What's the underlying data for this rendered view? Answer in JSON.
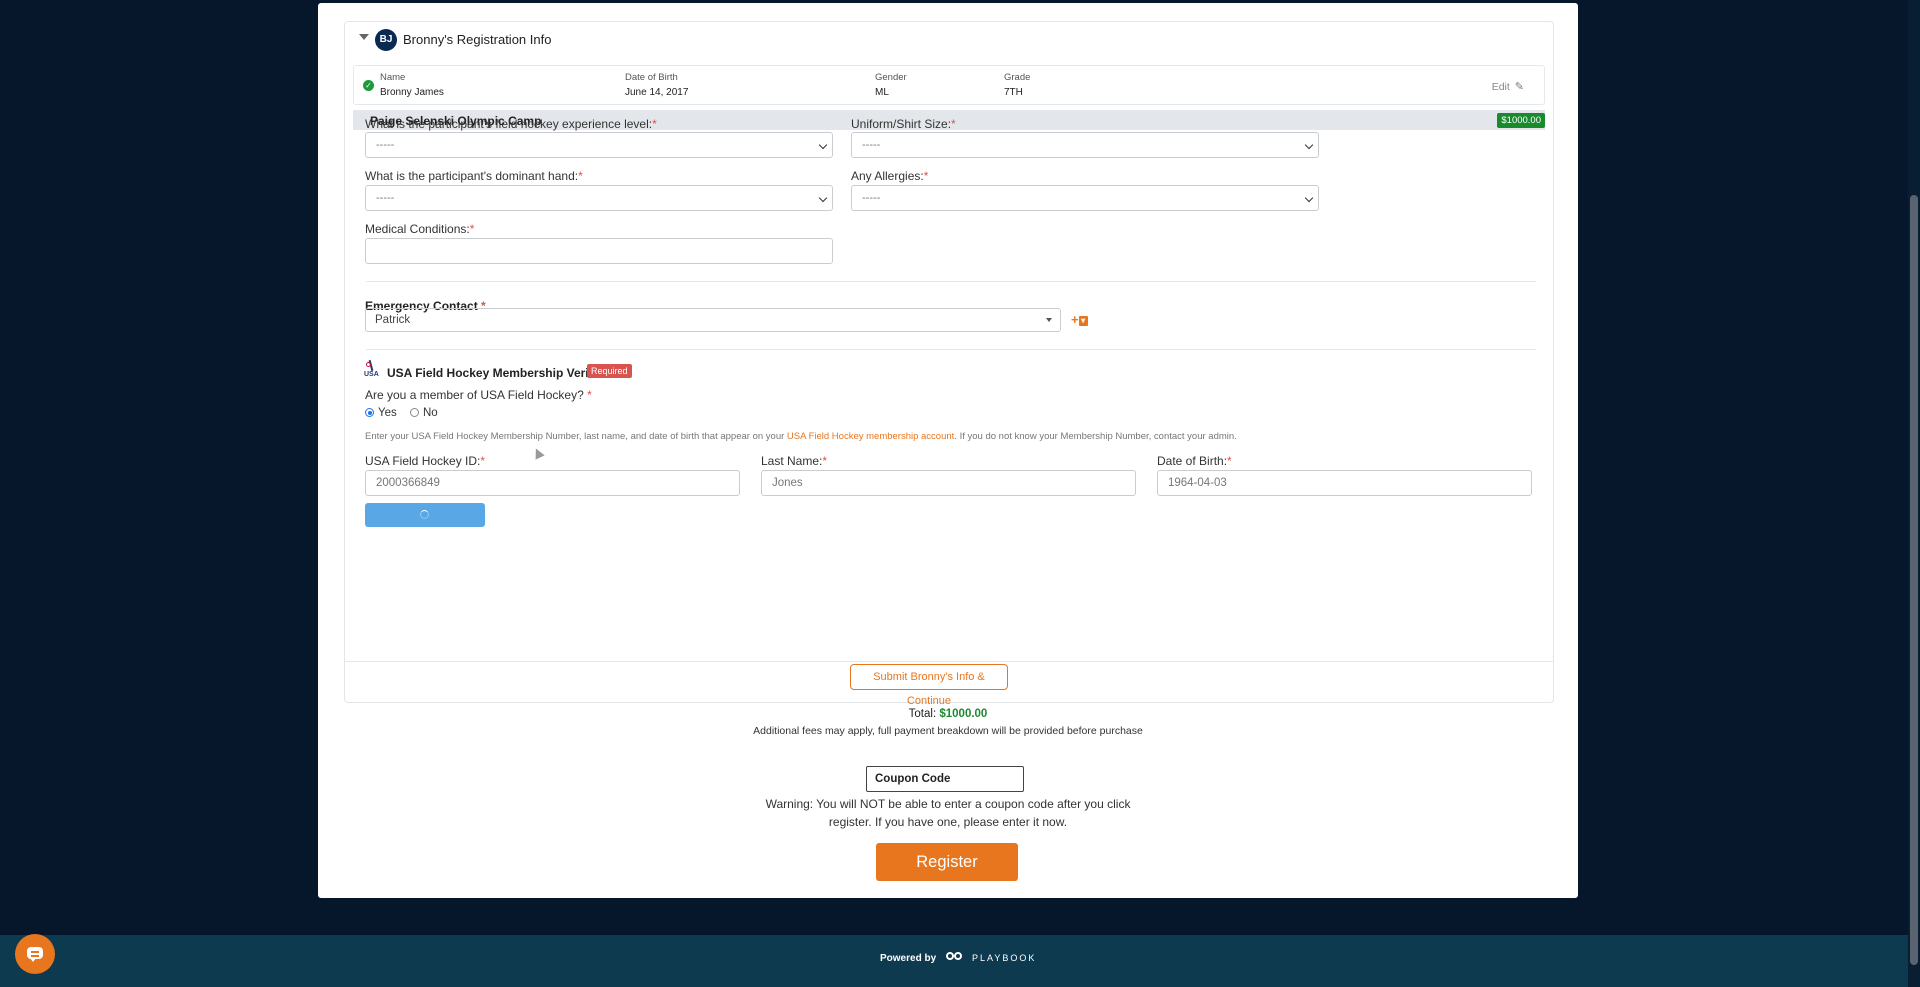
{
  "registration": {
    "avatar_initials": "BJ",
    "title": "Bronny's Registration Info",
    "summary": {
      "name_label": "Name",
      "name": "Bronny James",
      "dob_label": "Date of Birth",
      "dob": "June 14, 2017",
      "gender_label": "Gender",
      "gender": "ML",
      "grade_label": "Grade",
      "grade": "7TH",
      "edit_label": "Edit"
    }
  },
  "camp": {
    "name": "Paige Selenski Olympic Camp",
    "price": "$1000.00"
  },
  "questions": {
    "experience_label": "What is the participant's field hockey experience level:",
    "experience_value": "-----",
    "shirt_label": "Uniform/Shirt Size:",
    "shirt_value": "-----",
    "hand_label": "What is the participant's dominant hand:",
    "hand_value": "-----",
    "allergies_label": "Any Allergies:",
    "allergies_value": "-----",
    "medical_label": "Medical Conditions:",
    "required_mark": "*"
  },
  "emergency": {
    "label": "Emergency Contact",
    "value": "Patrick"
  },
  "usafh": {
    "title": "USA Field Hockey Membership Verification",
    "logo_text": "USA",
    "required_badge": "Required",
    "member_question": "Are you a member of USA Field Hockey?",
    "yes_label": "Yes",
    "no_label": "No",
    "selected": "Yes",
    "help_before": "Enter your USA Field Hockey Membership Number, last name, and date of birth that appear on your ",
    "help_link": "USA Field Hockey membership account",
    "help_after": ". If you do not know your Membership Number, contact your admin.",
    "id_label": "USA Field Hockey ID:",
    "id_value": "2000366849",
    "lastname_label": "Last Name:",
    "lastname_value": "Jones",
    "dob_label": "Date of Birth:",
    "dob_value": "1964-04-03"
  },
  "actions": {
    "submit_label": "Submit Bronny's Info & Continue",
    "total_label": "Total:",
    "total_amount": "$1000.00",
    "fees_note": "Additional fees may apply, full payment breakdown will be provided before purchase",
    "coupon_placeholder": "Coupon Code",
    "warning_line1": "Warning: You will NOT be able to enter a coupon code after you click",
    "warning_line2": "register. If you have one, please enter it now.",
    "register_label": "Register"
  },
  "footer": {
    "powered_by": "Powered by",
    "brand": "PLAYBOOK"
  },
  "colors": {
    "accent": "#e8761e",
    "success": "#1a8a2e",
    "navy": "#06172b"
  }
}
